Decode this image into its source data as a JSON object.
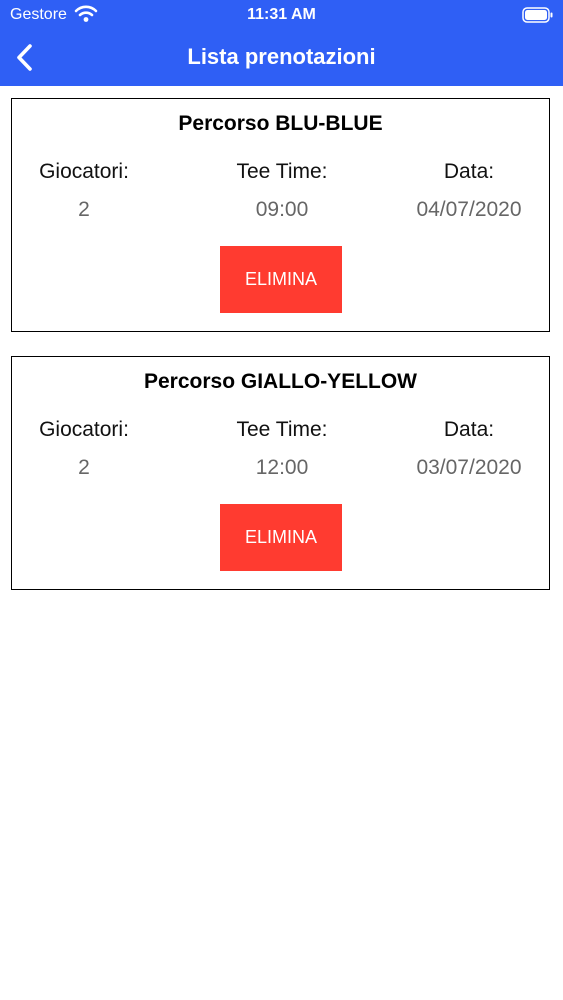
{
  "status_bar": {
    "carrier": "Gestore",
    "time": "11:31 AM",
    "icons": [
      "wifi-icon",
      "battery-icon"
    ]
  },
  "nav": {
    "title": "Lista prenotazioni",
    "back_icon": "chevron-left-icon"
  },
  "colors": {
    "nav_background": "#2f5ff5",
    "delete_button": "#ff3b30"
  },
  "bookings": [
    {
      "course": "Percorso BLU-BLUE",
      "players_label": "Giocatori:",
      "players": "2",
      "tee_time_label": "Tee Time:",
      "tee_time": "09:00",
      "date_label": "Data:",
      "date": "04/07/2020",
      "delete_label": "ELIMINA"
    },
    {
      "course": "Percorso GIALLO-YELLOW",
      "players_label": "Giocatori:",
      "players": "2",
      "tee_time_label": "Tee Time:",
      "tee_time": "12:00",
      "date_label": "Data:",
      "date": "03/07/2020",
      "delete_label": "ELIMINA"
    }
  ]
}
